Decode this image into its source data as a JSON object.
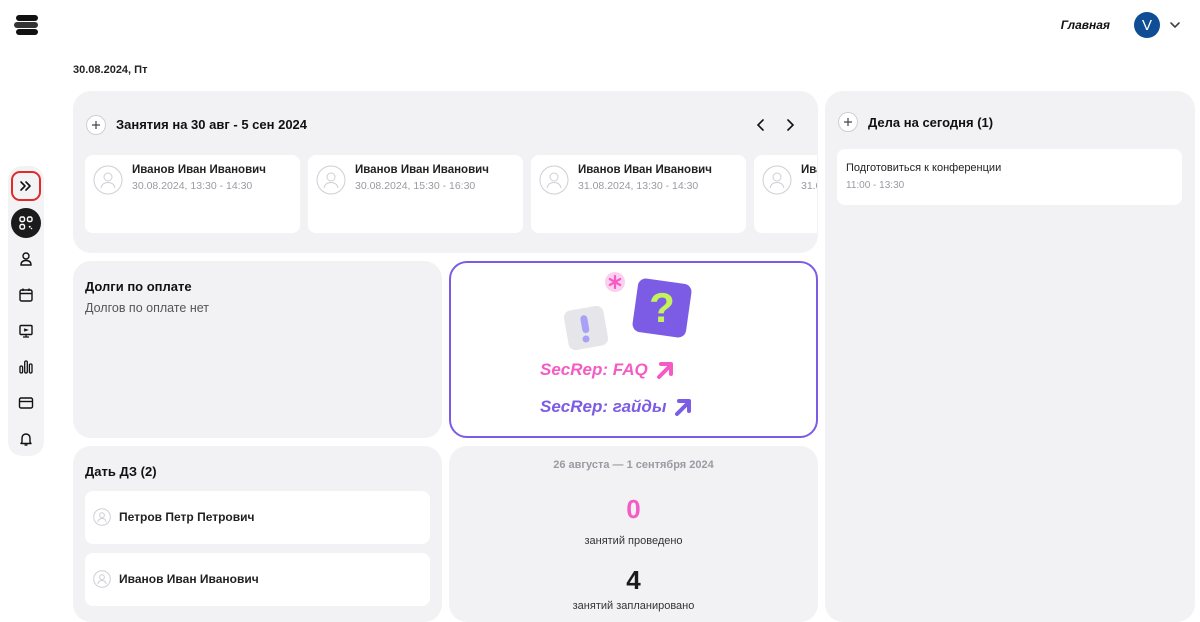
{
  "header": {
    "nav_home": "Главная",
    "avatar_initial": "V",
    "date": "30.08.2024, Пт"
  },
  "sidebar": {
    "items": [
      "expand-icon",
      "dashboard-icon",
      "user-icon",
      "calendar-icon",
      "lessons-icon",
      "stats-icon",
      "payment-icon",
      "bell-icon"
    ]
  },
  "lessons_widget": {
    "title": "Занятия на 30 авг - 5 сен 2024",
    "lessons": [
      {
        "name": "Иванов Иван Иванович",
        "time": "30.08.2024, 13:30 - 14:30"
      },
      {
        "name": "Иванов Иван Иванович",
        "time": "30.08.2024, 15:30 - 16:30"
      },
      {
        "name": "Иванов Иван Иванович",
        "time": "31.08.2024, 13:30 - 14:30"
      },
      {
        "name": "Ива",
        "time": "31.0"
      }
    ]
  },
  "debts_widget": {
    "title": "Долги по оплате",
    "empty_text": "Долгов по оплате нет"
  },
  "faq_widget": {
    "link_faq": "SecRep: FAQ",
    "link_guides": "SecRep: гайды",
    "colors": {
      "pink": "#f45bc4",
      "purple": "#7c5ce5",
      "lime": "#c4f25a"
    }
  },
  "homework_widget": {
    "title": "Дать ДЗ (2)",
    "students": [
      "Петров Петр Петрович",
      "Иванов Иван Иванович"
    ]
  },
  "stats_widget": {
    "range": "26 августа — 1 сентября 2024",
    "done_count": "0",
    "done_label": "занятий проведено",
    "planned_count": "4",
    "planned_label": "занятий запланировано",
    "colors": {
      "done": "#f45bc4",
      "planned": "#1a1a1a"
    }
  },
  "todo_widget": {
    "title": "Дела на сегодня (1)",
    "items": [
      {
        "text": "Подготовиться к конференции",
        "time": "11:00 - 13:30"
      }
    ]
  }
}
